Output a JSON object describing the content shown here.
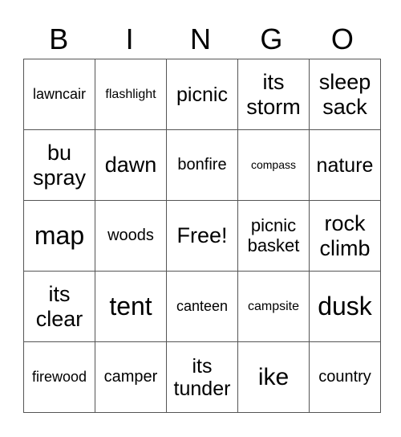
{
  "header": [
    "B",
    "I",
    "N",
    "G",
    "O"
  ],
  "grid": [
    [
      "lawncair",
      "flashlight",
      "picnic",
      "its\nstorm",
      "sleep\nsack"
    ],
    [
      "bu\nspray",
      "dawn",
      "bonfire",
      "compass",
      "nature"
    ],
    [
      "map",
      "woods",
      "Free!",
      "picnic\nbasket",
      "rock\nclimb"
    ],
    [
      "its\nclear",
      "tent",
      "canteen",
      "campsite",
      "dusk"
    ],
    [
      "firewood",
      "camper",
      "its\ntunder",
      "ike",
      "country"
    ]
  ]
}
